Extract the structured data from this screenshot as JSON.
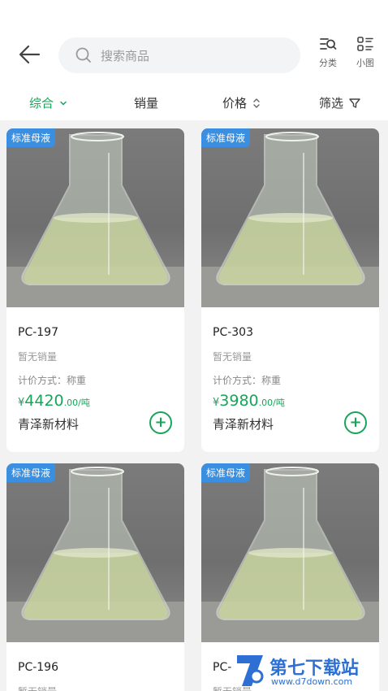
{
  "header": {
    "search_placeholder": "搜索商品",
    "category_label": "分类",
    "small_image_label": "小图"
  },
  "sort": {
    "comprehensive": "综合",
    "sales": "销量",
    "price": "价格",
    "filter": "筛选"
  },
  "products": [
    {
      "tag": "标准母液",
      "name": "PC-197",
      "sales": "暂无销量",
      "method": "计价方式：称重",
      "currency": "¥",
      "price": "4420",
      "unit": ".00/吨",
      "shop": "青泽新材料"
    },
    {
      "tag": "标准母液",
      "name": "PC-303",
      "sales": "暂无销量",
      "method": "计价方式：称重",
      "currency": "¥",
      "price": "3980",
      "unit": ".00/吨",
      "shop": "青泽新材料"
    },
    {
      "tag": "标准母液",
      "name": "PC-196",
      "sales": "暂无销量"
    },
    {
      "tag": "标准母液",
      "name": "PC-",
      "sales": "暂无销量"
    }
  ],
  "watermark": {
    "text": "第七下载站",
    "url": "www.d7down.com"
  },
  "colors": {
    "accent": "#19a45a",
    "tag_bg": "#3b8fe0"
  }
}
